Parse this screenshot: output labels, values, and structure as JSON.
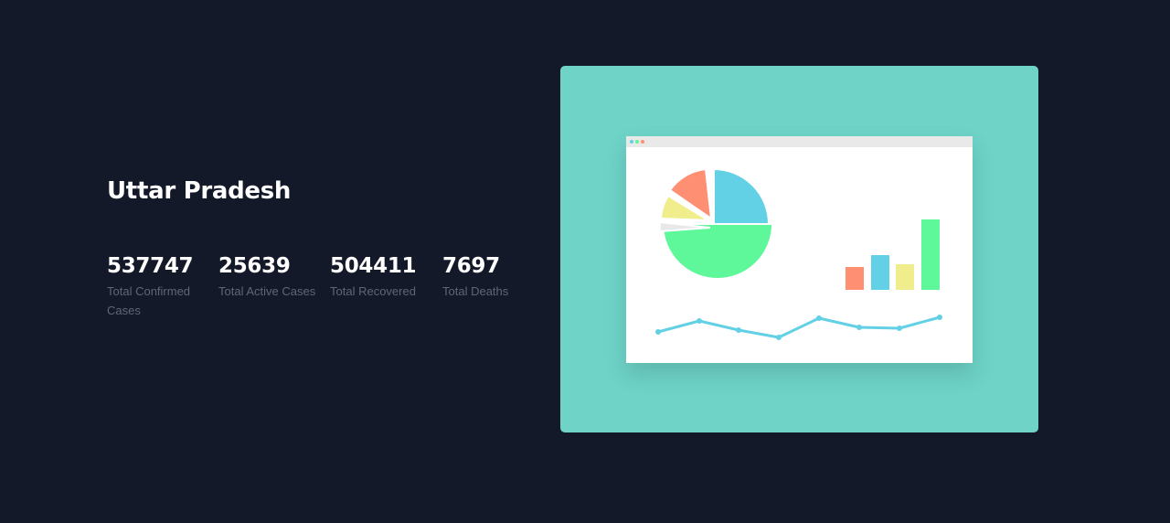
{
  "region": {
    "title": "Uttar Pradesh"
  },
  "stats": [
    {
      "value": "537747",
      "label": "Total Confirmed Cases"
    },
    {
      "value": "25639",
      "label": "Total Active Cases"
    },
    {
      "value": "504411",
      "label": "Total Recovered"
    },
    {
      "value": "7697",
      "label": "Total Deaths"
    }
  ],
  "illustration": {
    "card_color": "#6fd3c7",
    "browser_dot_colors": [
      "#62d0e5",
      "#5ef79a",
      "#ff8f72"
    ],
    "pie_colors": [
      "#62d0e5",
      "#5ef79a",
      "#e8e8e8",
      "#f0ed8c",
      "#ff8f72"
    ],
    "bar_colors": [
      "#ff8f72",
      "#62d0e5",
      "#f0ed8c",
      "#5ef79a"
    ],
    "line_color": "#62d0e5"
  },
  "colors": {
    "background": "#131928",
    "heading": "#ffffff",
    "label": "#5f6675"
  }
}
